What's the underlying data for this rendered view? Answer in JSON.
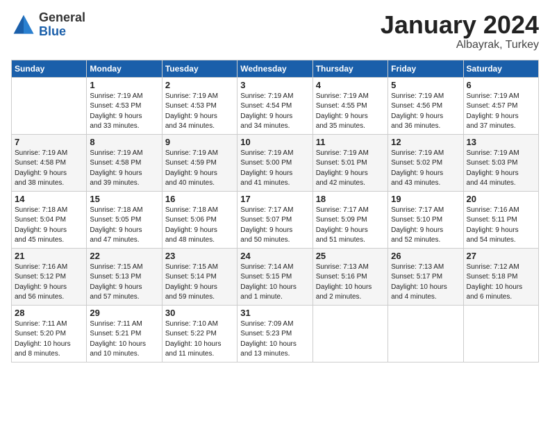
{
  "header": {
    "logo": {
      "general": "General",
      "blue": "Blue"
    },
    "title": "January 2024",
    "subtitle": "Albayrak, Turkey"
  },
  "weekdays": [
    "Sunday",
    "Monday",
    "Tuesday",
    "Wednesday",
    "Thursday",
    "Friday",
    "Saturday"
  ],
  "weeks": [
    [
      {
        "day": "",
        "info": ""
      },
      {
        "day": "1",
        "info": "Sunrise: 7:19 AM\nSunset: 4:53 PM\nDaylight: 9 hours\nand 33 minutes."
      },
      {
        "day": "2",
        "info": "Sunrise: 7:19 AM\nSunset: 4:53 PM\nDaylight: 9 hours\nand 34 minutes."
      },
      {
        "day": "3",
        "info": "Sunrise: 7:19 AM\nSunset: 4:54 PM\nDaylight: 9 hours\nand 34 minutes."
      },
      {
        "day": "4",
        "info": "Sunrise: 7:19 AM\nSunset: 4:55 PM\nDaylight: 9 hours\nand 35 minutes."
      },
      {
        "day": "5",
        "info": "Sunrise: 7:19 AM\nSunset: 4:56 PM\nDaylight: 9 hours\nand 36 minutes."
      },
      {
        "day": "6",
        "info": "Sunrise: 7:19 AM\nSunset: 4:57 PM\nDaylight: 9 hours\nand 37 minutes."
      }
    ],
    [
      {
        "day": "7",
        "info": "Sunrise: 7:19 AM\nSunset: 4:58 PM\nDaylight: 9 hours\nand 38 minutes."
      },
      {
        "day": "8",
        "info": "Sunrise: 7:19 AM\nSunset: 4:58 PM\nDaylight: 9 hours\nand 39 minutes."
      },
      {
        "day": "9",
        "info": "Sunrise: 7:19 AM\nSunset: 4:59 PM\nDaylight: 9 hours\nand 40 minutes."
      },
      {
        "day": "10",
        "info": "Sunrise: 7:19 AM\nSunset: 5:00 PM\nDaylight: 9 hours\nand 41 minutes."
      },
      {
        "day": "11",
        "info": "Sunrise: 7:19 AM\nSunset: 5:01 PM\nDaylight: 9 hours\nand 42 minutes."
      },
      {
        "day": "12",
        "info": "Sunrise: 7:19 AM\nSunset: 5:02 PM\nDaylight: 9 hours\nand 43 minutes."
      },
      {
        "day": "13",
        "info": "Sunrise: 7:19 AM\nSunset: 5:03 PM\nDaylight: 9 hours\nand 44 minutes."
      }
    ],
    [
      {
        "day": "14",
        "info": "Sunrise: 7:18 AM\nSunset: 5:04 PM\nDaylight: 9 hours\nand 45 minutes."
      },
      {
        "day": "15",
        "info": "Sunrise: 7:18 AM\nSunset: 5:05 PM\nDaylight: 9 hours\nand 47 minutes."
      },
      {
        "day": "16",
        "info": "Sunrise: 7:18 AM\nSunset: 5:06 PM\nDaylight: 9 hours\nand 48 minutes."
      },
      {
        "day": "17",
        "info": "Sunrise: 7:17 AM\nSunset: 5:07 PM\nDaylight: 9 hours\nand 50 minutes."
      },
      {
        "day": "18",
        "info": "Sunrise: 7:17 AM\nSunset: 5:09 PM\nDaylight: 9 hours\nand 51 minutes."
      },
      {
        "day": "19",
        "info": "Sunrise: 7:17 AM\nSunset: 5:10 PM\nDaylight: 9 hours\nand 52 minutes."
      },
      {
        "day": "20",
        "info": "Sunrise: 7:16 AM\nSunset: 5:11 PM\nDaylight: 9 hours\nand 54 minutes."
      }
    ],
    [
      {
        "day": "21",
        "info": "Sunrise: 7:16 AM\nSunset: 5:12 PM\nDaylight: 9 hours\nand 56 minutes."
      },
      {
        "day": "22",
        "info": "Sunrise: 7:15 AM\nSunset: 5:13 PM\nDaylight: 9 hours\nand 57 minutes."
      },
      {
        "day": "23",
        "info": "Sunrise: 7:15 AM\nSunset: 5:14 PM\nDaylight: 9 hours\nand 59 minutes."
      },
      {
        "day": "24",
        "info": "Sunrise: 7:14 AM\nSunset: 5:15 PM\nDaylight: 10 hours\nand 1 minute."
      },
      {
        "day": "25",
        "info": "Sunrise: 7:13 AM\nSunset: 5:16 PM\nDaylight: 10 hours\nand 2 minutes."
      },
      {
        "day": "26",
        "info": "Sunrise: 7:13 AM\nSunset: 5:17 PM\nDaylight: 10 hours\nand 4 minutes."
      },
      {
        "day": "27",
        "info": "Sunrise: 7:12 AM\nSunset: 5:18 PM\nDaylight: 10 hours\nand 6 minutes."
      }
    ],
    [
      {
        "day": "28",
        "info": "Sunrise: 7:11 AM\nSunset: 5:20 PM\nDaylight: 10 hours\nand 8 minutes."
      },
      {
        "day": "29",
        "info": "Sunrise: 7:11 AM\nSunset: 5:21 PM\nDaylight: 10 hours\nand 10 minutes."
      },
      {
        "day": "30",
        "info": "Sunrise: 7:10 AM\nSunset: 5:22 PM\nDaylight: 10 hours\nand 11 minutes."
      },
      {
        "day": "31",
        "info": "Sunrise: 7:09 AM\nSunset: 5:23 PM\nDaylight: 10 hours\nand 13 minutes."
      },
      {
        "day": "",
        "info": ""
      },
      {
        "day": "",
        "info": ""
      },
      {
        "day": "",
        "info": ""
      }
    ]
  ]
}
